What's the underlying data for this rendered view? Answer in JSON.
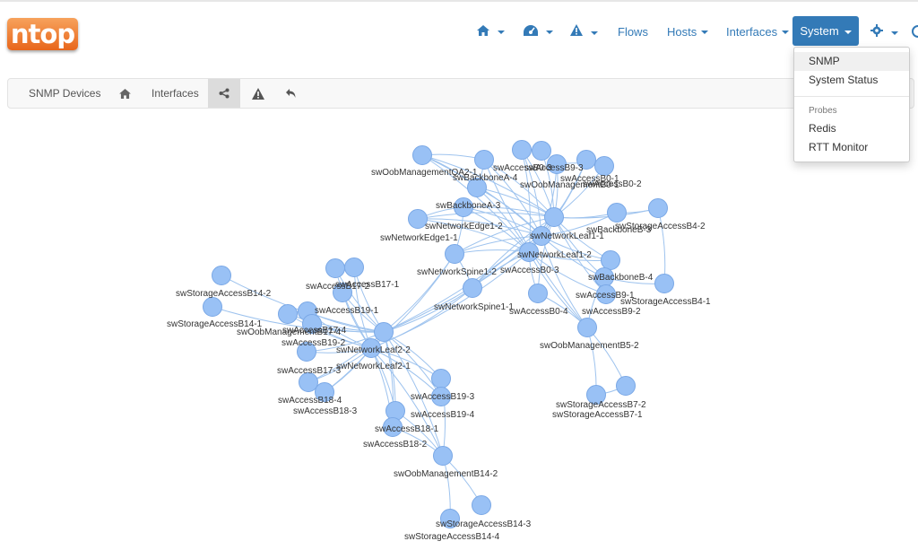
{
  "logo": "ntop",
  "navbar": {
    "flows": "Flows",
    "hosts": "Hosts",
    "interfaces": "Interfaces",
    "system": "System"
  },
  "system_menu": {
    "snmp": "SNMP",
    "system_status": "System Status",
    "probes_header": "Probes",
    "redis": "Redis",
    "rtt_monitor": "RTT Monitor"
  },
  "subnav": {
    "snmp_devices": "SNMP Devices",
    "interfaces": "Interfaces"
  },
  "colors": {
    "accent": "#337ab7",
    "node": "#99c1f5",
    "edge": "#9ec3ee",
    "logo": "#f0812f"
  },
  "graph": {
    "labels": [
      "swOobManagementQA2-1",
      "swBackboneA-4",
      "swAccessB0-3",
      "swAccessB9-3",
      "swOobManagementB0-1",
      "swAccessB0-1",
      "swAccessB0-2",
      "swBackboneA-3",
      "swNetworkEdge1-2",
      "swNetworkEdge1-1",
      "swNetworkLeaf1-1",
      "swBackboneB-3",
      "swStorageAccessB4-2",
      "swNetworkLeaf1-2",
      "swNetworkSpine1-2",
      "swAccessB0-3",
      "swBackboneB-4",
      "swAccessB9-1",
      "swAccessB9-2",
      "swStorageAccessB4-1",
      "swNetworkSpine1-1",
      "swAccessB0-4",
      "swOobManagementB5-2",
      "swStorageAccessB14-2",
      "swAccessB17-2",
      "swAccessB17-1",
      "swAccessB19-1",
      "swStorageAccessB14-1",
      "swOobManagementB17-4",
      "swAccessB17-4",
      "swAccessB19-2",
      "swNetworkLeaf2-2",
      "swNetworkLeaf2-1",
      "swAccessB17-3",
      "swAccessB18-4",
      "swAccessB18-3",
      "swAccessB19-3",
      "swAccessB19-4",
      "swAccessB18-1",
      "swAccessB18-2",
      "swOobManagementB14-2",
      "swStorageAccessB7-2",
      "swStorageAccessB7-1",
      "swStorageAccessB14-3",
      "swStorageAccessB14-4"
    ]
  }
}
